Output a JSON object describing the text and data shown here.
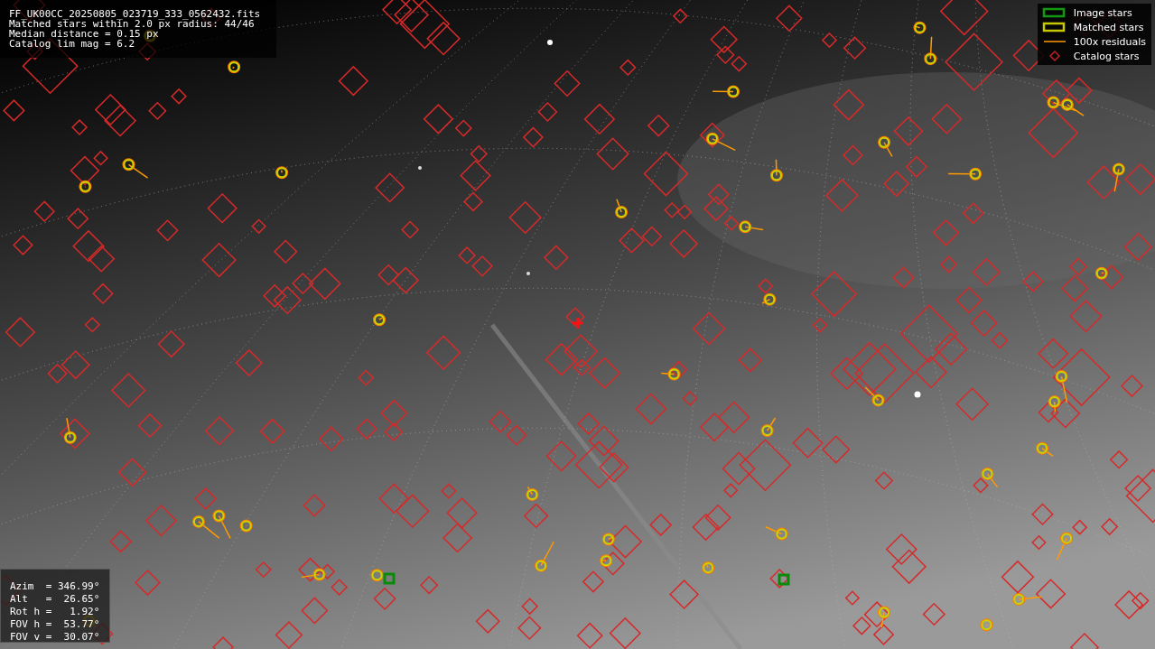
{
  "info": {
    "lines": [
      "FF_UK00CC_20250805_023719_333_0562432.fits",
      "Matched stars within 2.0 px radius: 44/46",
      "Median distance = 0.15 px",
      "Catalog lim mag = 6.2"
    ]
  },
  "legend": [
    {
      "label": "Image stars"
    },
    {
      "kind": "matched",
      "label": "Matched stars"
    },
    {
      "kind": "residual",
      "label": "100x residuals"
    },
    {
      "kind": "catalog",
      "label": "Catalog stars"
    }
  ],
  "pointing": {
    "lines": [
      "Azim  = 346.99°",
      "Alt   =  26.65°",
      "Rot h =   1.92°",
      "FOV h =  53.77°",
      "FOV v =  30.07°"
    ]
  }
}
